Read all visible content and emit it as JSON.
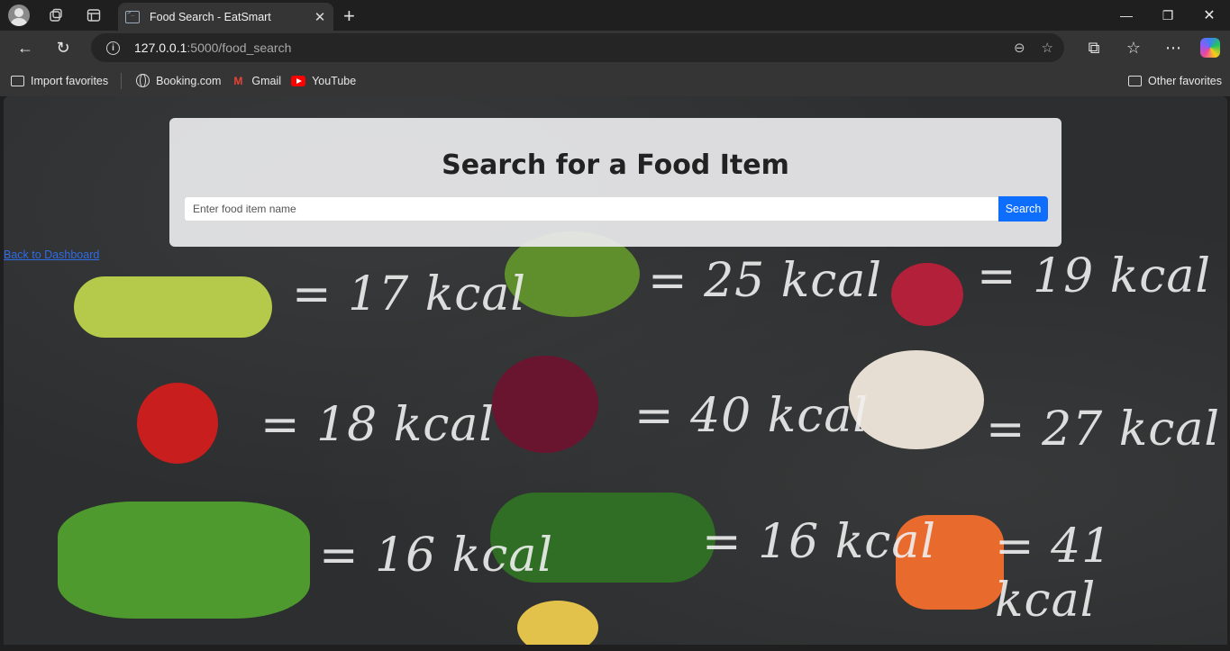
{
  "browser": {
    "tab_title": "Food Search - EatSmart",
    "url_host": "127.0.0.1",
    "url_path": ":5000/food_search",
    "bookmarks": [
      "Import favorites",
      "Booking.com",
      "Gmail",
      "YouTube"
    ],
    "other_favorites": "Other favorites"
  },
  "page": {
    "title": "Search for a Food Item",
    "search_placeholder": "Enter food item name",
    "search_button": "Search",
    "back_link": "Back to Dashboard"
  },
  "background_chalk": [
    "= 17 kcal",
    "= 25 kcal",
    "= 19 kcal",
    "= 18 kcal",
    "= 40 kcal",
    "= 27 kcal",
    "= 16 kcal",
    "= 16 kcal",
    "= 41 kcal"
  ],
  "colors": {
    "accent": "#0d6efd",
    "link": "#2f6ce5",
    "chalkboard": "#2c2e2f"
  }
}
